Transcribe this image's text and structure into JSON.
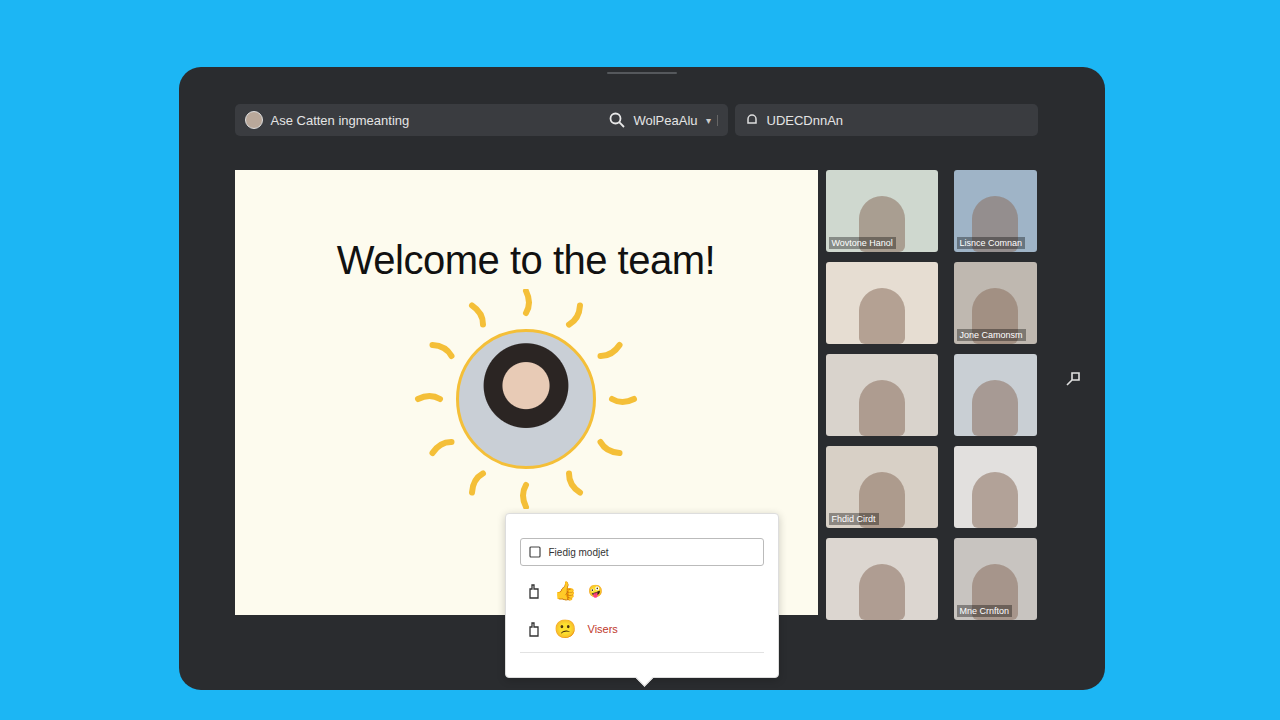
{
  "window": {
    "title": "Ase Catten ingmeanting"
  },
  "topbar": {
    "meeting": "Ase Catten ingmeanting",
    "search": "WolPeaAlu",
    "device": "UDECDnnAn"
  },
  "slide": {
    "title": "Welcome to the team!"
  },
  "participants": [
    {
      "label": "Wovtone Hanol"
    },
    {
      "label": "Lisnce Comnan"
    },
    {},
    {
      "label": "Jone Camonsm"
    },
    {},
    {},
    {
      "label": "Fhdid Cirdt"
    },
    {},
    {},
    {
      "label": "Mne Crnfton"
    }
  ],
  "popup": {
    "field": "Fiedig modjet",
    "reactions": [
      {
        "emoji": "👍",
        "extra": "🤪"
      },
      {
        "emoji": "😕",
        "label": "Visers"
      }
    ]
  }
}
